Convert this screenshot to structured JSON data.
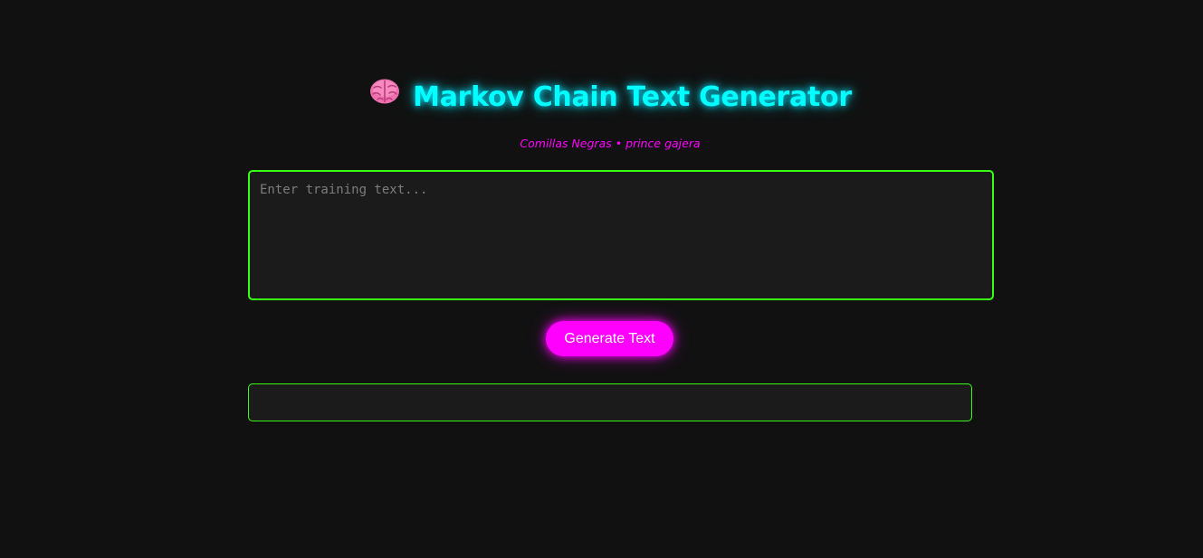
{
  "header": {
    "title_icon": "brain-icon",
    "title": "Markov Chain Text Generator",
    "subtitle": "Comillas Negras • prince gajera"
  },
  "input": {
    "value": "",
    "placeholder": "Enter training text..."
  },
  "actions": {
    "generate_label": "Generate Text"
  },
  "output": {
    "text": ""
  },
  "colors": {
    "background": "#111111",
    "title": "#00ffff",
    "accent": "#ff00ff",
    "border": "#39ff14",
    "field": "#1b1b1b"
  }
}
